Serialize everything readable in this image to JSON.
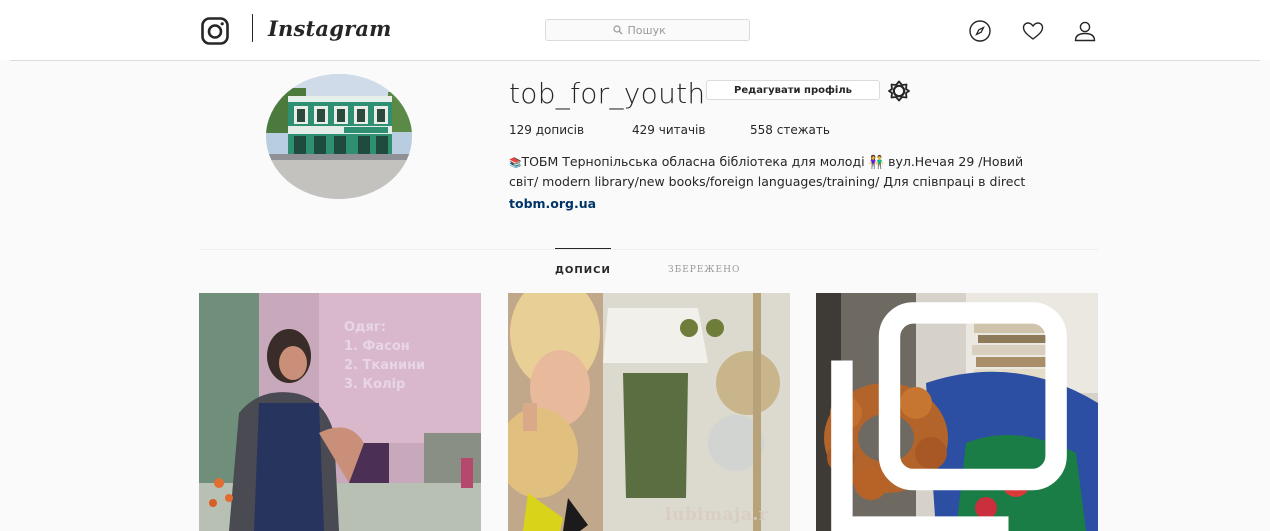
{
  "header": {
    "wordmark": "Instagram",
    "search_placeholder": "Пошук"
  },
  "profile": {
    "username": "tob_for_youth",
    "edit_label": "Редагувати профіль",
    "stats": [
      {
        "value": "129",
        "label": "дописів"
      },
      {
        "value": "429",
        "label": "читачів"
      },
      {
        "value": "558",
        "label": "стежать"
      }
    ],
    "bio_line1": "ТОБМ Тернопільська обласна бібліотека для молоді 👫 вул.Нечая 29 /Новий",
    "bio_line2": "світ/ modern library/new books/foreign languages/training/ Для співпраці в direct",
    "link": "tobm.org.ua",
    "avatar_sign": "БІБЛІОТЕКА"
  },
  "tabs": {
    "posts": "ДОПИСИ",
    "saved": "ЗБЕРЕЖЕНО"
  },
  "posts": [
    {
      "slide_lines": [
        "Одяг:",
        "1. Фасон",
        "2. Тканини",
        "3. Колір"
      ]
    },
    {
      "watermark": "lubimaja.r"
    },
    {
      "multi": true
    }
  ],
  "colors": {
    "link": "#003569",
    "border": "#dbdbdb",
    "background": "#fafafa"
  }
}
